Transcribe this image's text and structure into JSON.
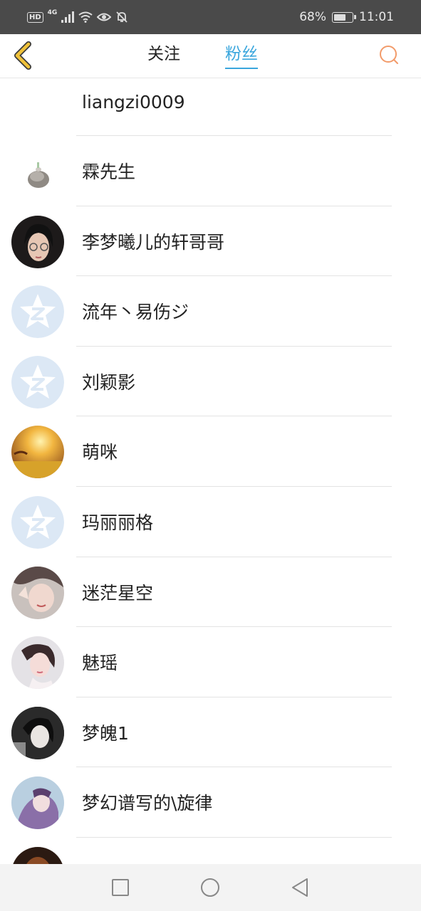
{
  "status_bar": {
    "hd": "HD",
    "network": "4G",
    "battery_text": "68%",
    "battery_level": 0.68,
    "time": "11:01"
  },
  "header": {
    "back_icon": "chevron-left-icon",
    "tabs": [
      {
        "label": "关注",
        "active": false
      },
      {
        "label": "粉丝",
        "active": true
      }
    ],
    "search_icon": "search-icon",
    "colors": {
      "accent": "#3aa6dd",
      "back": "#f0c23a",
      "search": "#f29b6a"
    }
  },
  "fans": [
    {
      "name": "liangzi0009",
      "avatar": "none"
    },
    {
      "name": "霖先生",
      "avatar": "photo"
    },
    {
      "name": "李梦曦儿的轩哥哥",
      "avatar": "photo"
    },
    {
      "name": "流年丶易伤ジ",
      "avatar": "default-qzone"
    },
    {
      "name": "刘颖影",
      "avatar": "default-qzone"
    },
    {
      "name": "萌咪",
      "avatar": "photo"
    },
    {
      "name": "玛丽丽格",
      "avatar": "default-qzone"
    },
    {
      "name": "迷茫星空",
      "avatar": "photo"
    },
    {
      "name": "魅瑶",
      "avatar": "photo"
    },
    {
      "name": "梦魄1",
      "avatar": "photo"
    },
    {
      "name": "梦幻谱写的\\旋律",
      "avatar": "photo"
    },
    {
      "name": "",
      "avatar": "photo"
    }
  ],
  "nav_bar": {
    "recents_icon": "square-icon",
    "home_icon": "circle-icon",
    "back_icon": "triangle-back-icon"
  }
}
